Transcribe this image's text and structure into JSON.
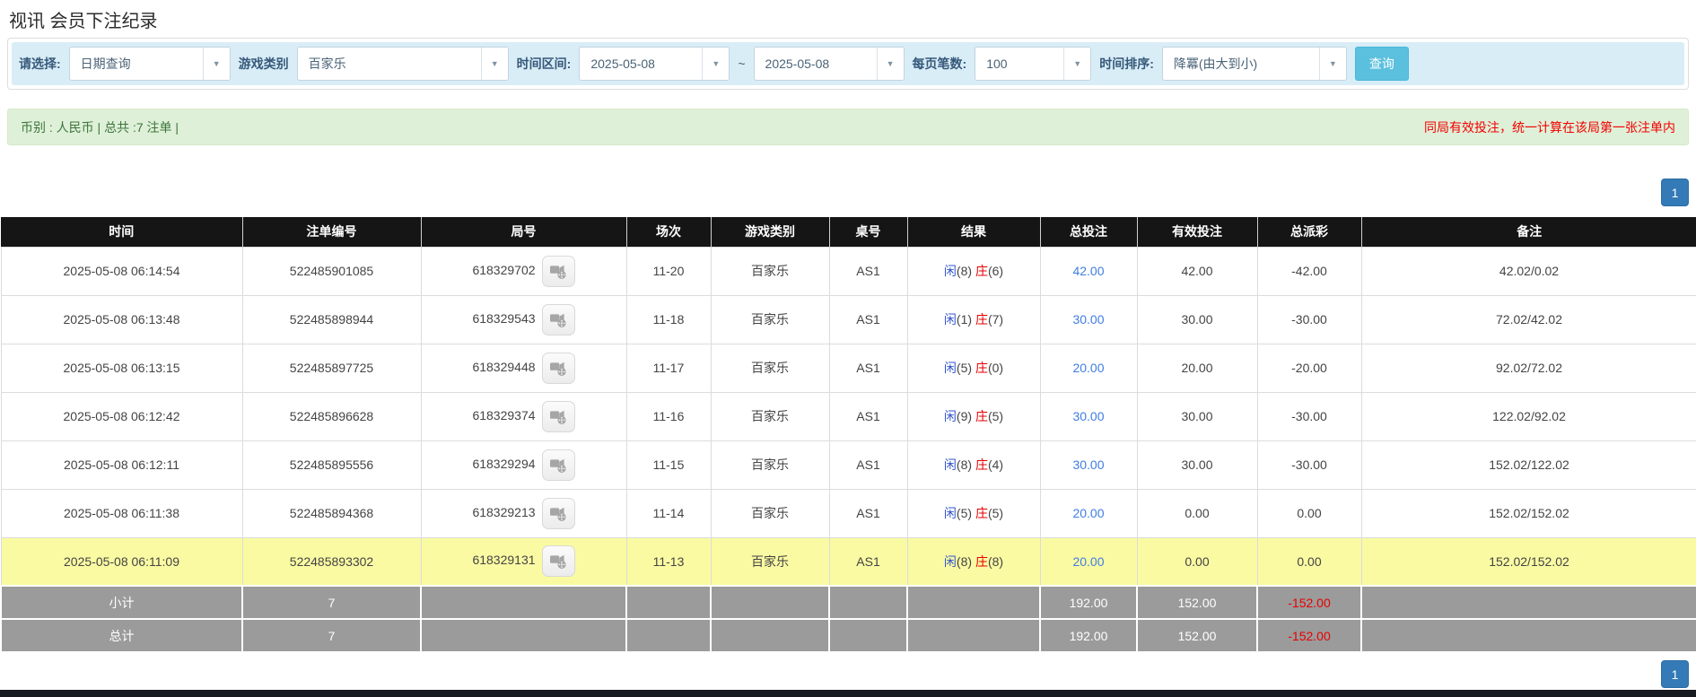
{
  "page": {
    "title": "视讯 会员下注纪录"
  },
  "colors": {
    "accent_blue": "#337ab7",
    "search_button_cyan": "#5bc0de",
    "filter_bar_bg": "#d9edf7",
    "summary_bar_bg": "#dff0d8",
    "summary_text_green": "#3c763d",
    "notice_red": "#f20000",
    "negative_red": "#e60000",
    "player_blue": "#3355cc",
    "amount_link_blue": "#3f7de0",
    "highlight_yellow": "#fafaa3",
    "totals_gray": "#9b9b9b",
    "header_black": "#151515"
  },
  "filter_bar": {
    "select_type": {
      "label": "请选择:",
      "value": "日期查询"
    },
    "game_category": {
      "label": "游戏类别",
      "value": "百家乐"
    },
    "time_range": {
      "label": "时间区间:",
      "from": "2025-05-08",
      "separator": "~",
      "to": "2025-05-08"
    },
    "page_size": {
      "label": "每页笔数:",
      "value": "100"
    },
    "time_sort": {
      "label": "时间排序:",
      "value": "降冪(由大到小)"
    },
    "search_button": "查询"
  },
  "summary_bar": {
    "left_text": "币别 : 人民币 | 总共 :7 注单 |",
    "right_notice": "同局有效投注，统一计算在该局第一张注单内"
  },
  "pagination": {
    "current_page": "1"
  },
  "table": {
    "headers": [
      "时间",
      "注单编号",
      "局号",
      "场次",
      "游戏类别",
      "桌号",
      "结果",
      "总投注",
      "有效投注",
      "总派彩",
      "备注"
    ],
    "rows": [
      {
        "time": "2025-05-08 06:14:54",
        "bet_id": "522485901085",
        "round_id": "618329702",
        "session": "11-20",
        "game": "百家乐",
        "table_no": "AS1",
        "result": {
          "player_label": "闲",
          "player_value": "(8)",
          "banker_label": "庄",
          "banker_value": "(6)"
        },
        "total_bet": "42.00",
        "valid_bet": "42.00",
        "payout": "-42.00",
        "remark": "42.02/0.02",
        "highlighted": false
      },
      {
        "time": "2025-05-08 06:13:48",
        "bet_id": "522485898944",
        "round_id": "618329543",
        "session": "11-18",
        "game": "百家乐",
        "table_no": "AS1",
        "result": {
          "player_label": "闲",
          "player_value": "(1)",
          "banker_label": "庄",
          "banker_value": "(7)"
        },
        "total_bet": "30.00",
        "valid_bet": "30.00",
        "payout": "-30.00",
        "remark": "72.02/42.02",
        "highlighted": false
      },
      {
        "time": "2025-05-08 06:13:15",
        "bet_id": "522485897725",
        "round_id": "618329448",
        "session": "11-17",
        "game": "百家乐",
        "table_no": "AS1",
        "result": {
          "player_label": "闲",
          "player_value": "(5)",
          "banker_label": "庄",
          "banker_value": "(0)"
        },
        "total_bet": "20.00",
        "valid_bet": "20.00",
        "payout": "-20.00",
        "remark": "92.02/72.02",
        "highlighted": false
      },
      {
        "time": "2025-05-08 06:12:42",
        "bet_id": "522485896628",
        "round_id": "618329374",
        "session": "11-16",
        "game": "百家乐",
        "table_no": "AS1",
        "result": {
          "player_label": "闲",
          "player_value": "(9)",
          "banker_label": "庄",
          "banker_value": "(5)"
        },
        "total_bet": "30.00",
        "valid_bet": "30.00",
        "payout": "-30.00",
        "remark": "122.02/92.02",
        "highlighted": false
      },
      {
        "time": "2025-05-08 06:12:11",
        "bet_id": "522485895556",
        "round_id": "618329294",
        "session": "11-15",
        "game": "百家乐",
        "table_no": "AS1",
        "result": {
          "player_label": "闲",
          "player_value": "(8)",
          "banker_label": "庄",
          "banker_value": "(4)"
        },
        "total_bet": "30.00",
        "valid_bet": "30.00",
        "payout": "-30.00",
        "remark": "152.02/122.02",
        "highlighted": false
      },
      {
        "time": "2025-05-08 06:11:38",
        "bet_id": "522485894368",
        "round_id": "618329213",
        "session": "11-14",
        "game": "百家乐",
        "table_no": "AS1",
        "result": {
          "player_label": "闲",
          "player_value": "(5)",
          "banker_label": "庄",
          "banker_value": "(5)"
        },
        "total_bet": "20.00",
        "valid_bet": "0.00",
        "payout": "0.00",
        "remark": "152.02/152.02",
        "highlighted": false
      },
      {
        "time": "2025-05-08 06:11:09",
        "bet_id": "522485893302",
        "round_id": "618329131",
        "session": "11-13",
        "game": "百家乐",
        "table_no": "AS1",
        "result": {
          "player_label": "闲",
          "player_value": "(8)",
          "banker_label": "庄",
          "banker_value": "(8)"
        },
        "total_bet": "20.00",
        "valid_bet": "0.00",
        "payout": "0.00",
        "remark": "152.02/152.02",
        "highlighted": true
      }
    ],
    "totals": [
      {
        "label": "小计",
        "count": "7",
        "total_bet": "192.00",
        "valid_bet": "152.00",
        "payout": "-152.00"
      },
      {
        "label": "总计",
        "count": "7",
        "total_bet": "192.00",
        "valid_bet": "152.00",
        "payout": "-152.00"
      }
    ]
  }
}
